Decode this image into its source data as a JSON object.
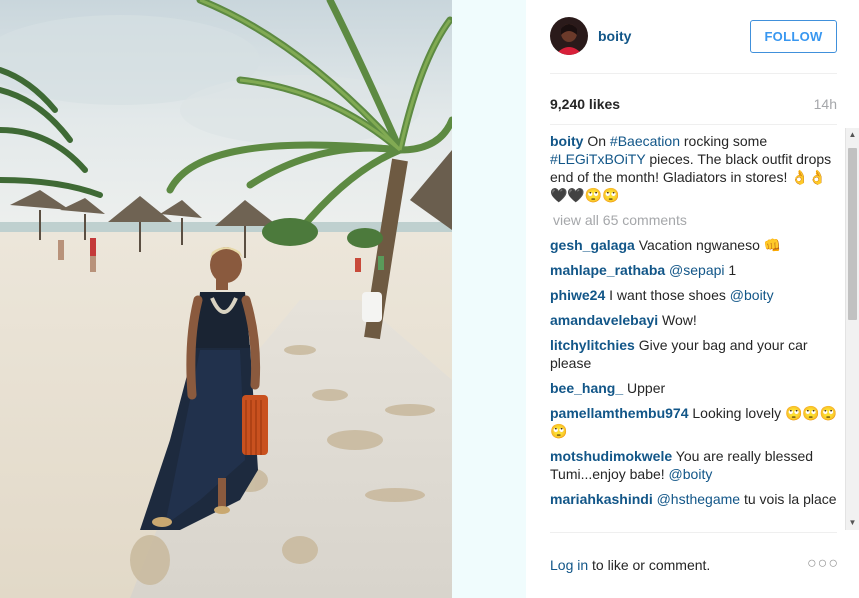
{
  "post": {
    "username": "boity",
    "follow_label": "FOLLOW",
    "likes": "9,240 likes",
    "time": "14h"
  },
  "caption": {
    "author": "boity",
    "text_1": " On ",
    "tag_1": "#Baecation",
    "text_2": " rocking some ",
    "tag_2": "#LEGiTxBOiTY",
    "text_3": " pieces. The black outfit drops end of the month! Gladiators in stores! 👌👌🖤🖤🙄🙄"
  },
  "view_all": "view all 65 comments",
  "comments": [
    {
      "author": "gesh_galaga",
      "text": " Vacation ngwaneso 👊"
    },
    {
      "author": "mahlape_rathaba",
      "tag": " @sepapi",
      "text": "  1"
    },
    {
      "author": "phiwe24",
      "text": " I want those shoes ",
      "tag_after": "@boity"
    },
    {
      "author": "amandavelebayi",
      "text": " Wow!"
    },
    {
      "author": "litchylitchies",
      "text": " Give your bag and your car please"
    },
    {
      "author": "bee_hang_",
      "text": " Upper"
    },
    {
      "author": "pamellamthembu974",
      "text": " Looking lovely 🙄🙄🙄🙄"
    },
    {
      "author": "motshudimokwele",
      "text": " You are really blessed Tumi...enjoy babe! ",
      "tag_after": "@boity"
    },
    {
      "author": "mariahkashindi",
      "tag": " @hsthegame",
      "text": " tu vois la place"
    }
  ],
  "footer": {
    "login_link": "Log in",
    "login_rest": " to like or comment.",
    "more": "○○○"
  },
  "colors": {
    "link_blue": "#125688",
    "follow_blue": "#3897f0",
    "muted_gray": "#a5a7aa"
  },
  "icons": {
    "more": "more-options-icon",
    "avatar": "profile-avatar"
  }
}
